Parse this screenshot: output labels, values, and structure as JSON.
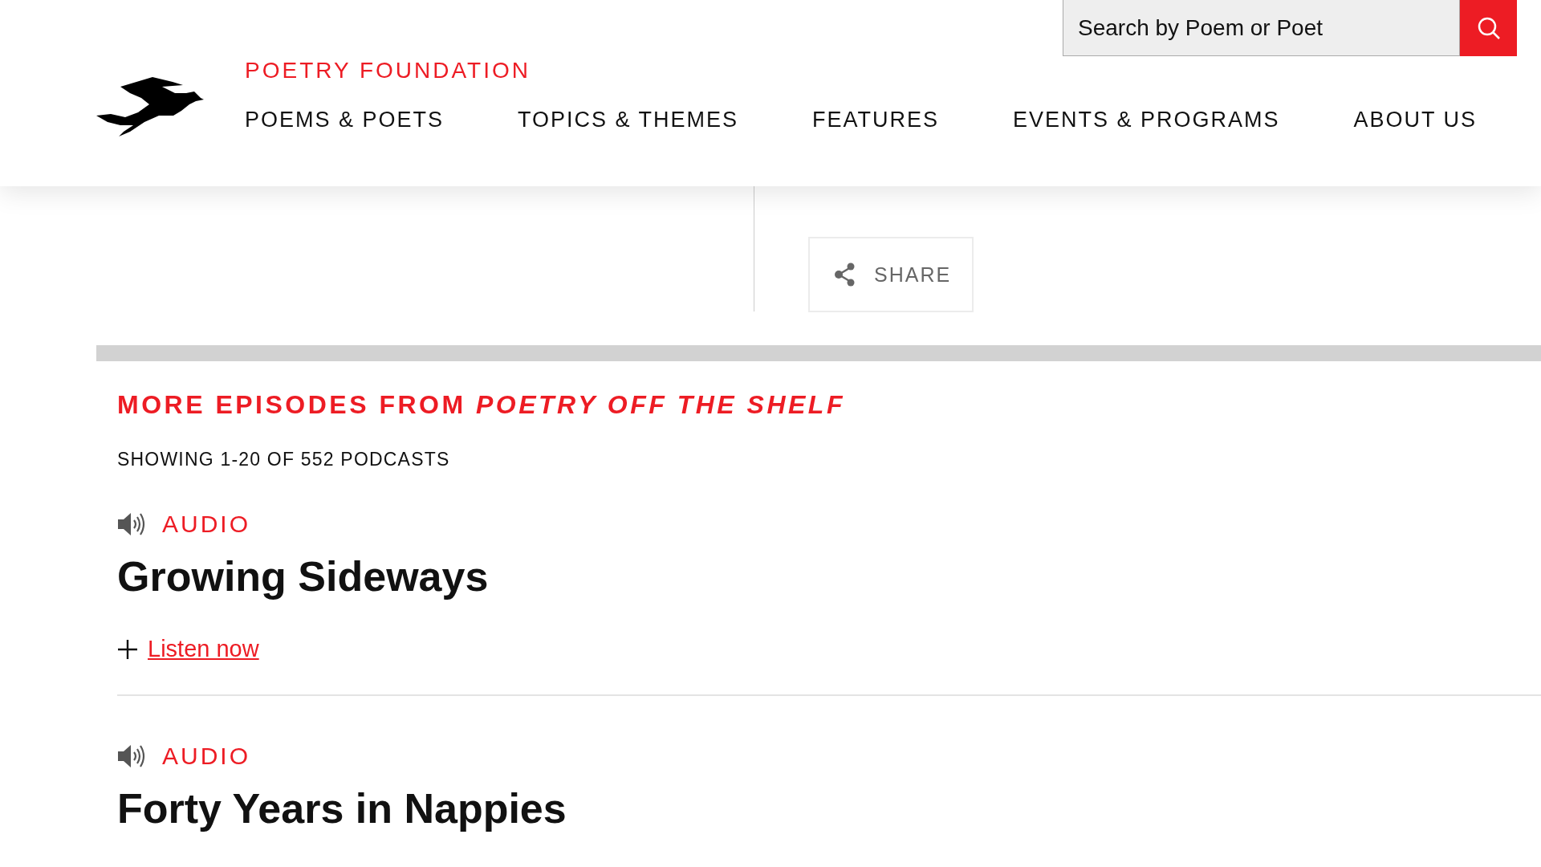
{
  "header": {
    "brand": "POETRY FOUNDATION",
    "search": {
      "placeholder": "Search by Poem or Poet"
    },
    "nav": [
      "POEMS & POETS",
      "TOPICS & THEMES",
      "FEATURES",
      "EVENTS & PROGRAMS",
      "ABOUT US"
    ]
  },
  "share": {
    "label": "SHARE"
  },
  "episodes": {
    "heading": "MORE EPISODES FROM *POETRY OFF THE SHELF*",
    "count": "SHOWING 1-20 OF 552 PODCASTS",
    "items": [
      {
        "type": "AUDIO",
        "title": "Growing Sideways",
        "action": "Listen now"
      },
      {
        "type": "AUDIO",
        "title": "Forty Years in Nappies"
      }
    ]
  }
}
